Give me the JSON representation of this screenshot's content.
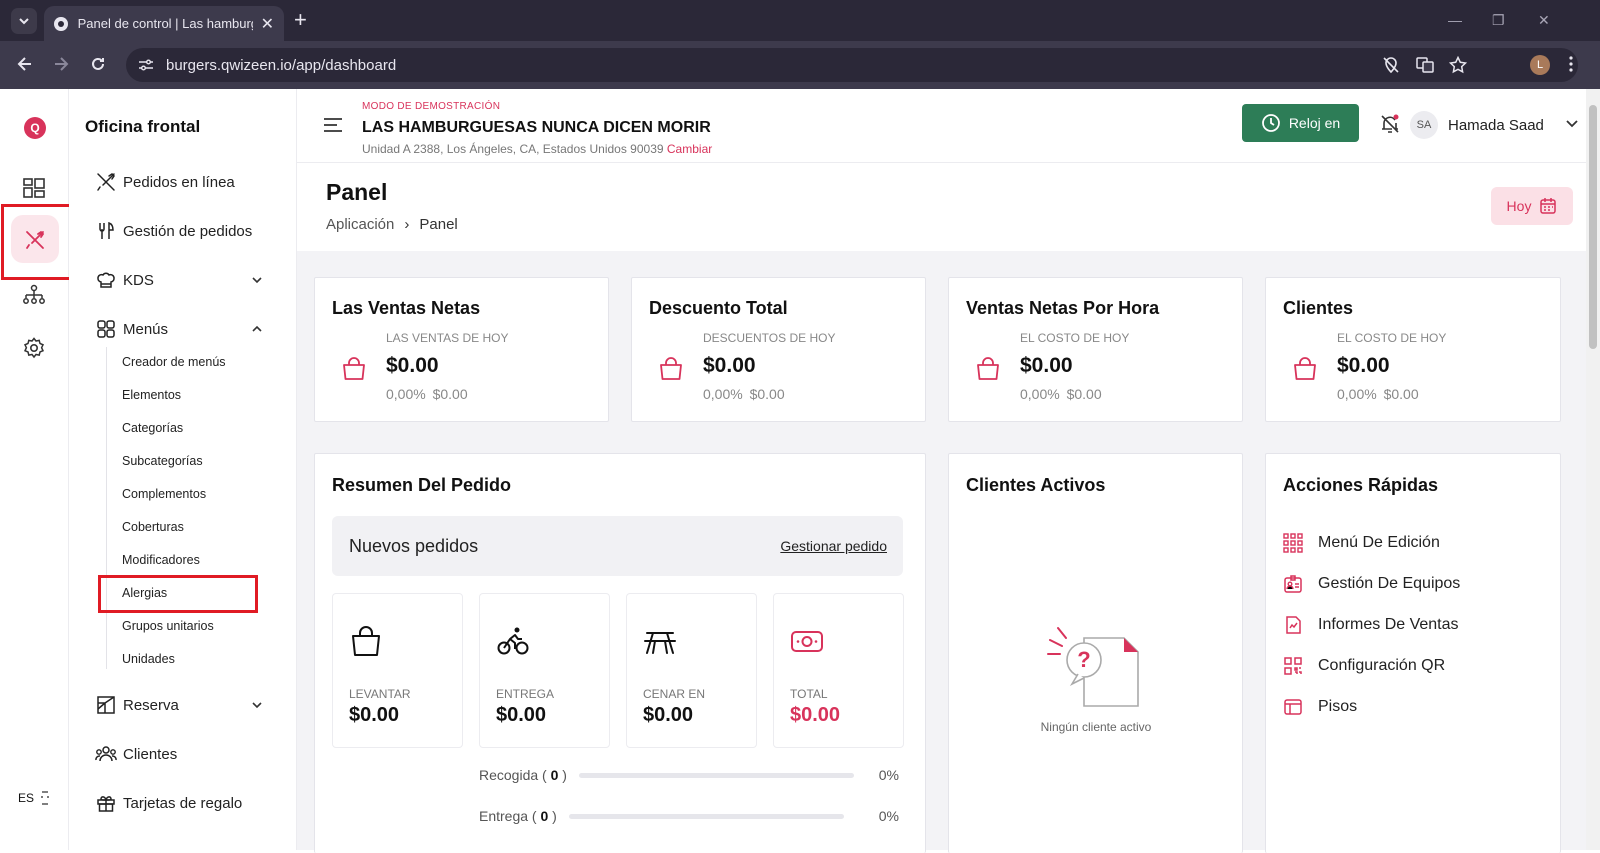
{
  "browser": {
    "tab_title": "Panel de control | Las hamburguesas nunca dicen morir",
    "url": "burgers.qwizeen.io/app/dashboard",
    "profile_initial": "L"
  },
  "rail": {
    "logo": "Q",
    "icons": [
      "dashboard-icon",
      "cutlery-icon",
      "hierarchy-icon",
      "settings-icon"
    ],
    "language": "ES"
  },
  "menu": {
    "title": "Oficina frontal",
    "items": [
      {
        "label": "Pedidos en línea",
        "icon": "cutlery-cross-icon"
      },
      {
        "label": "Gestión de pedidos",
        "icon": "fork-knife-icon"
      },
      {
        "label": "KDS",
        "icon": "chef-hat-icon"
      },
      {
        "label": "Menús",
        "icon": "grid-icon"
      },
      {
        "label": "Reserva",
        "icon": "table-icon"
      },
      {
        "label": "Clientes",
        "icon": "users-icon"
      },
      {
        "label": "Tarjetas de regalo",
        "icon": "gift-icon"
      }
    ],
    "submenu": [
      "Creador de menús",
      "Elementos",
      "Categorías",
      "Subcategorías",
      "Complementos",
      "Coberturas",
      "Modificadores",
      "Alergias",
      "Grupos unitarios",
      "Unidades"
    ]
  },
  "header": {
    "demo_mode": "MODO DE DEMOSTRACIÓN",
    "store_name": "LAS HAMBURGUESAS NUNCA DICEN MORIR",
    "address": "Unidad A 2388, Los Ángeles, CA, Estados Unidos 90039",
    "change_link": "Cambiar",
    "clock_in": "Reloj en",
    "user_initials": "SA",
    "user_name": "Hamada Saad"
  },
  "page": {
    "title": "Panel",
    "breadcrumb": [
      "Aplicación",
      "Panel"
    ],
    "today_button": "Hoy"
  },
  "stats": [
    {
      "title": "Las Ventas Netas",
      "subtitle": "LAS VENTAS DE HOY",
      "value": "$0.00",
      "pct": "0,00%",
      "delta": "$0.00"
    },
    {
      "title": "Descuento Total",
      "subtitle": "DESCUENTOS DE HOY",
      "value": "$0.00",
      "pct": "0,00%",
      "delta": "$0.00"
    },
    {
      "title": "Ventas Netas Por Hora",
      "subtitle": "EL COSTO DE HOY",
      "value": "$0.00",
      "pct": "0,00%",
      "delta": "$0.00"
    },
    {
      "title": "Clientes",
      "subtitle": "EL COSTO DE HOY",
      "value": "$0.00",
      "pct": "0,00%",
      "delta": "$0.00"
    }
  ],
  "order_summary": {
    "title": "Resumen Del Pedido",
    "new_orders": "Nuevos pedidos",
    "manage_link": "Gestionar pedido",
    "tiles": [
      {
        "label": "LEVANTAR",
        "value": "$0.00"
      },
      {
        "label": "ENTREGA",
        "value": "$0.00"
      },
      {
        "label": "CENAR EN",
        "value": "$0.00"
      },
      {
        "label": "TOTAL",
        "value": "$0.00"
      }
    ],
    "progress": [
      {
        "label": "Recogida",
        "count": "0",
        "pct": "0%"
      },
      {
        "label": "Entrega",
        "count": "0",
        "pct": "0%"
      }
    ]
  },
  "active_customers": {
    "title": "Clientes Activos",
    "empty": "Ningún cliente activo"
  },
  "quick_actions": {
    "title": "Acciones Rápidas",
    "items": [
      {
        "label": "Menú De Edición",
        "icon": "grid-dots-icon"
      },
      {
        "label": "Gestión De Equipos",
        "icon": "id-badge-icon"
      },
      {
        "label": "Informes De Ventas",
        "icon": "report-icon"
      },
      {
        "label": "Configuración QR",
        "icon": "qr-icon"
      },
      {
        "label": "Pisos",
        "icon": "layout-icon"
      }
    ]
  },
  "colors": {
    "accent": "#d8335b",
    "success": "#2d7d57",
    "highlight_box": "#e01b24"
  }
}
